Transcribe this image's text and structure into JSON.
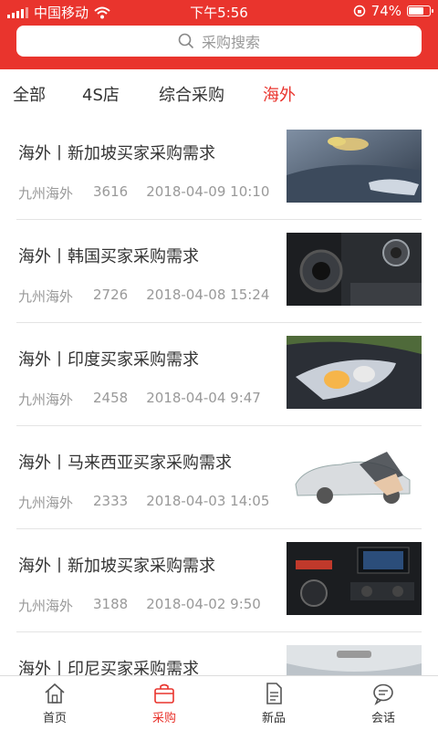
{
  "status_bar": {
    "carrier": "中国移动",
    "time": "下午5:56",
    "battery": "74%",
    "battery_level": 0.74
  },
  "search": {
    "placeholder": "采购搜索"
  },
  "tabs": [
    {
      "label": "全部",
      "active": false
    },
    {
      "label": "4S店",
      "active": false
    },
    {
      "label": "综合采购",
      "active": false
    },
    {
      "label": "海外",
      "active": true
    }
  ],
  "items": [
    {
      "title": "海外丨新加坡买家采购需求",
      "source": "九州海外",
      "views": "3616",
      "date": "2018-04-09 10:10",
      "image": "car-hood-cleaning"
    },
    {
      "title": "海外丨韩国买家采购需求",
      "source": "九州海外",
      "views": "2726",
      "date": "2018-04-08 15:24",
      "image": "car-speaker"
    },
    {
      "title": "海外丨印度买家采购需求",
      "source": "九州海外",
      "views": "2458",
      "date": "2018-04-04 9:47",
      "image": "car-headlight"
    },
    {
      "title": "海外丨马来西亚买家采购需求",
      "source": "九州海外",
      "views": "2333",
      "date": "2018-04-03 14:05",
      "image": "window-tint-film"
    },
    {
      "title": "海外丨新加坡买家采购需求",
      "source": "九州海外",
      "views": "3188",
      "date": "2018-04-02 9:50",
      "image": "car-dashboard"
    },
    {
      "title": "海外丨印尼买家采购需求",
      "source": "",
      "views": "",
      "date": "",
      "image": "car-interior-roof"
    }
  ],
  "tabbar": [
    {
      "label": "首页",
      "icon": "home-icon",
      "active": false
    },
    {
      "label": "采购",
      "icon": "bag-icon",
      "active": true
    },
    {
      "label": "新品",
      "icon": "document-icon",
      "active": false
    },
    {
      "label": "会话",
      "icon": "chat-icon",
      "active": false
    }
  ],
  "colors": {
    "brand": "#e9342d",
    "text": "#333333",
    "muted": "#999999"
  }
}
